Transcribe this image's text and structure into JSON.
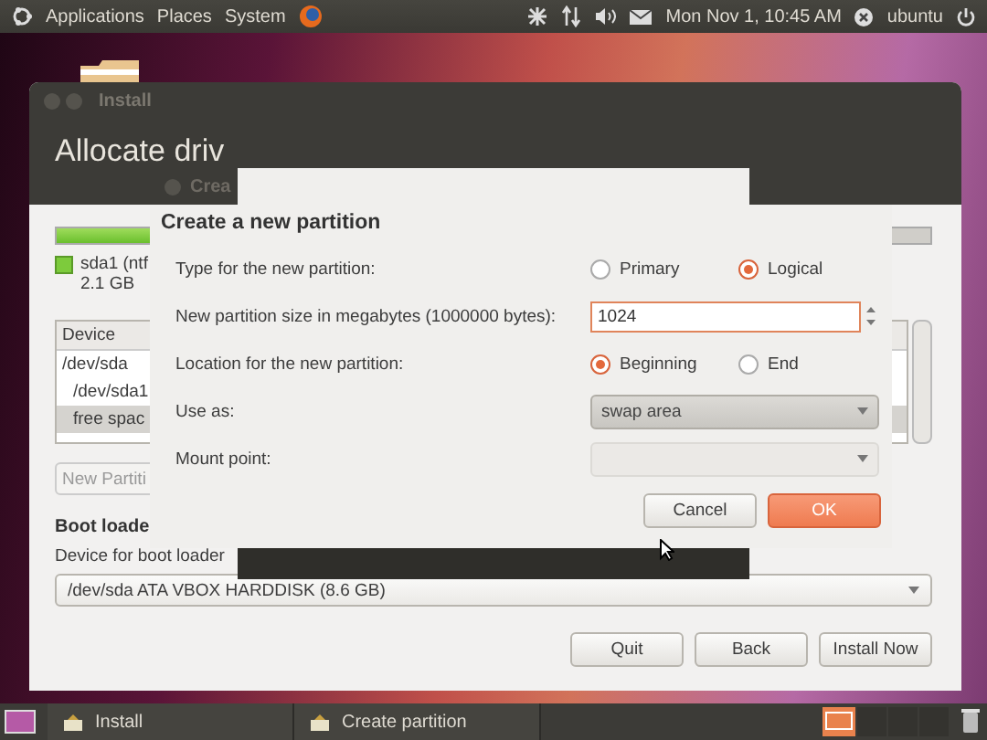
{
  "top_panel": {
    "menus": [
      "Applications",
      "Places",
      "System"
    ],
    "clock": "Mon Nov  1, 10:45 AM",
    "user": "ubuntu"
  },
  "install_window": {
    "title": "Install",
    "heading": "Allocate driv",
    "legend": {
      "name": "sda1 (ntf",
      "size": "2.1 GB"
    },
    "table": {
      "columns": [
        "Device"
      ],
      "rows": [
        {
          "device": "/dev/sda",
          "selected": false,
          "children": [
            {
              "device": "/dev/sda1",
              "selected": false
            },
            {
              "device": "free spac",
              "selected": true
            }
          ]
        }
      ]
    },
    "new_partition_button": "New Partiti",
    "boot_loader_heading": "Boot loade",
    "boot_loader_label": "Device for boot loader",
    "boot_loader_device": "/dev/sda ATA VBOX HARDDISK (8.6 GB)",
    "buttons": [
      "Quit",
      "Back",
      "Install Now"
    ]
  },
  "dialog": {
    "title": "Crea",
    "heading": "Create a new partition",
    "fields": [
      {
        "kind": "radio",
        "label": "Type for the new partition:",
        "options": [
          {
            "label": "Primary",
            "selected": false
          },
          {
            "label": "Logical",
            "selected": true
          }
        ]
      },
      {
        "kind": "spin",
        "label": "New partition size in megabytes (1000000 bytes):",
        "value": "1024"
      },
      {
        "kind": "radio",
        "label": "Location for the new partition:",
        "options": [
          {
            "label": "Beginning",
            "selected": true
          },
          {
            "label": "End",
            "selected": false
          }
        ]
      },
      {
        "kind": "combo",
        "label": "Use as:",
        "value": "swap area",
        "disabled": false
      },
      {
        "kind": "combo",
        "label": "Mount point:",
        "disabled": true
      }
    ],
    "buttons": [
      {
        "label": "Cancel",
        "default": false
      },
      {
        "label": "OK",
        "default": true
      }
    ]
  },
  "taskbar": {
    "tasks": [
      {
        "label": "Install",
        "selected": false
      },
      {
        "label": "Create partition",
        "selected": false
      }
    ]
  }
}
